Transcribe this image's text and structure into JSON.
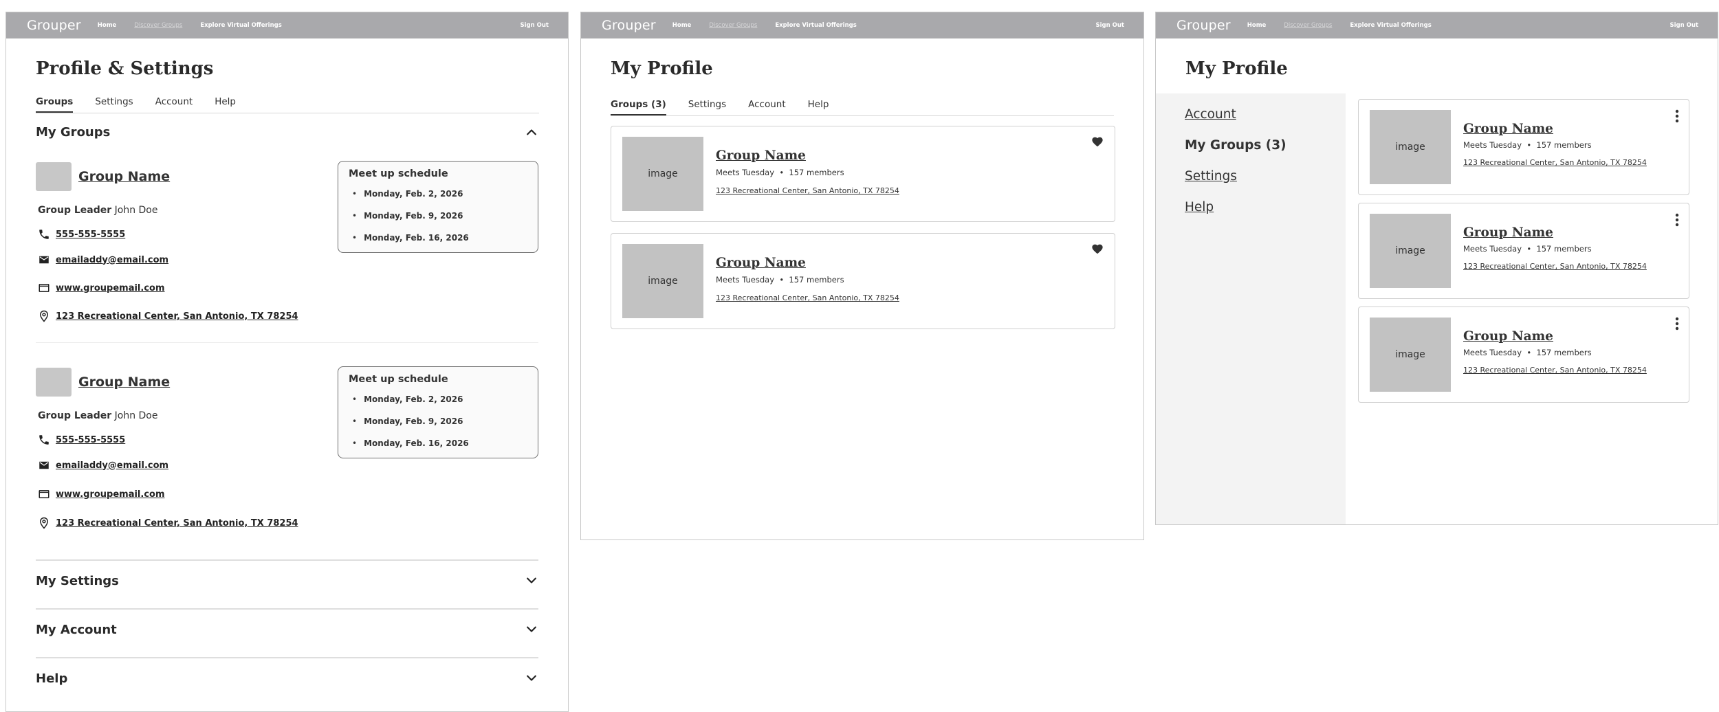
{
  "nav": {
    "logo": "Grouper",
    "home": "Home",
    "discover": "Discover Groups",
    "explore": "Explore Virtual Offerings",
    "signout": "Sign Out"
  },
  "panel1": {
    "title": "Profile & Settings",
    "tabs": [
      "Groups",
      "Settings",
      "Account",
      "Help"
    ],
    "my_groups": "My Groups",
    "groups": [
      {
        "name": "Group Name",
        "leader_label": "Group Leader",
        "leader_name": "John Doe",
        "phone": "555-555-5555",
        "email": "emailaddy@email.com",
        "website": "www.groupemail.com",
        "address": "123 Recreational Center, San Antonio, TX 78254",
        "schedule_title": "Meet up schedule",
        "schedule": [
          "Monday, Feb. 2, 2026",
          "Monday, Feb. 9, 2026",
          "Monday, Feb. 16, 2026"
        ]
      },
      {
        "name": "Group Name",
        "leader_label": "Group Leader",
        "leader_name": "John Doe",
        "phone": "555-555-5555",
        "email": "emailaddy@email.com",
        "website": "www.groupemail.com",
        "address": "123 Recreational Center, San Antonio, TX 78254",
        "schedule_title": "Meet up schedule",
        "schedule": [
          "Monday, Feb. 2, 2026",
          "Monday, Feb. 9, 2026",
          "Monday, Feb. 16, 2026"
        ]
      }
    ],
    "sections": [
      "My Settings",
      "My Account",
      "Help"
    ]
  },
  "panel2": {
    "title": "My Profile",
    "tabs": [
      "Groups (3)",
      "Settings",
      "Account",
      "Help"
    ],
    "cards": [
      {
        "image": "image",
        "name": "Group Name",
        "meets": "Meets Tuesday",
        "members": "157 members",
        "address": "123 Recreational Center, San Antonio, TX 78254"
      },
      {
        "image": "image",
        "name": "Group Name",
        "meets": "Meets Tuesday",
        "members": "157 members",
        "address": "123 Recreational Center, San Antonio, TX 78254"
      }
    ]
  },
  "panel3": {
    "title": "My Profile",
    "sidebar": [
      "Account",
      "My Groups (3)",
      "Settings",
      "Help"
    ],
    "cards": [
      {
        "image": "image",
        "name": "Group Name",
        "meets": "Meets Tuesday",
        "members": "157 members",
        "address": "123 Recreational Center, San Antonio, TX 78254"
      },
      {
        "image": "image",
        "name": "Group Name",
        "meets": "Meets Tuesday",
        "members": "157 members",
        "address": "123 Recreational Center, San Antonio, TX 78254"
      },
      {
        "image": "image",
        "name": "Group Name",
        "meets": "Meets Tuesday",
        "members": "157 members",
        "address": "123 Recreational Center, San Antonio, TX 78254"
      }
    ]
  }
}
